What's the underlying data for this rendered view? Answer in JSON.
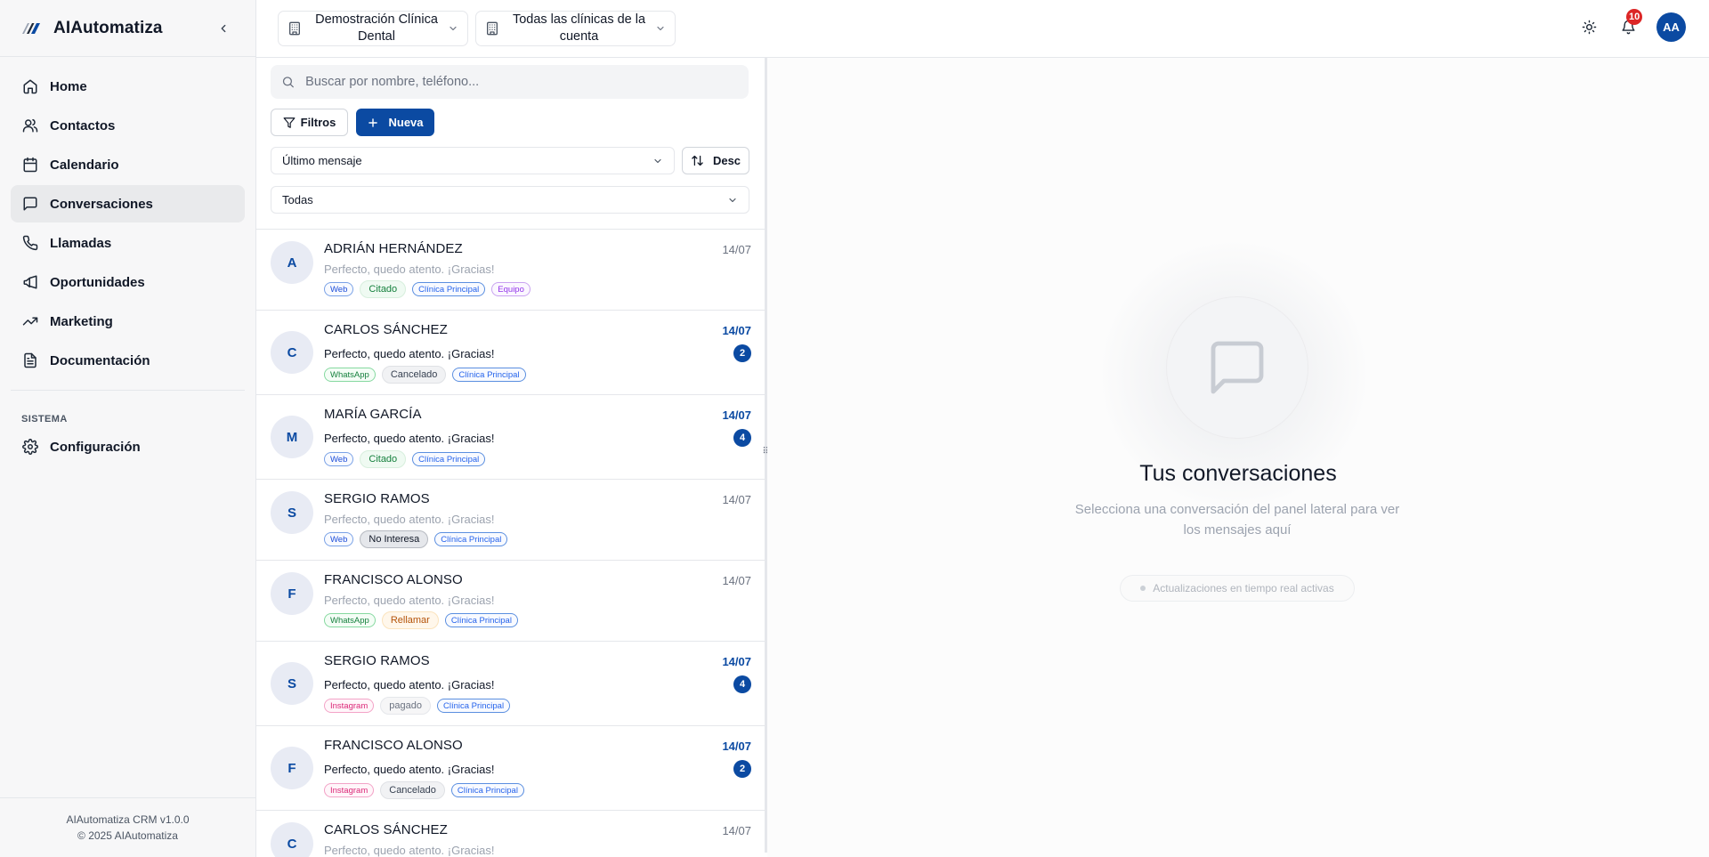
{
  "brand": {
    "name": "AIAutomatiza"
  },
  "nav": {
    "items": [
      {
        "label": "Home",
        "icon": "home-icon"
      },
      {
        "label": "Contactos",
        "icon": "users-icon"
      },
      {
        "label": "Calendario",
        "icon": "calendar-icon"
      },
      {
        "label": "Conversaciones",
        "icon": "message-square-icon",
        "active": true
      },
      {
        "label": "Llamadas",
        "icon": "phone-icon"
      },
      {
        "label": "Oportunidades",
        "icon": "megaphone-icon"
      },
      {
        "label": "Marketing",
        "icon": "trending-up-icon"
      },
      {
        "label": "Documentación",
        "icon": "file-text-icon"
      }
    ],
    "section_label": "SISTEMA",
    "settings_label": "Configuración"
  },
  "footer": {
    "version": "AIAutomatiza CRM v1.0.0",
    "copyright": "© 2025 AIAutomatiza"
  },
  "topbar": {
    "clinic_select": "Demostración Clínica Dental",
    "account_select": "Todas las clínicas de la cuenta",
    "notifications_count": "10",
    "user_initials": "AA"
  },
  "list": {
    "search_placeholder": "Buscar por nombre, teléfono...",
    "filters_label": "Filtros",
    "new_label": "Nueva",
    "sort_value": "Último mensaje",
    "sort_dir_label": "Desc",
    "status_value": "Todas",
    "conversations": [
      {
        "initial": "A",
        "name": "ADRIÁN HERNÁNDEZ",
        "message": "Perfecto, quedo atento. ¡Gracias!",
        "date": "14/07",
        "unread": "",
        "tags": [
          {
            "label": "Web",
            "kind": "web"
          },
          {
            "label": "Citado",
            "kind": "citado"
          },
          {
            "label": "Clínica Principal",
            "kind": "clinic"
          },
          {
            "label": "Equipo",
            "kind": "equipo"
          }
        ]
      },
      {
        "initial": "C",
        "name": "CARLOS SÁNCHEZ",
        "message": "Perfecto, quedo atento. ¡Gracias!",
        "date": "14/07",
        "unread": "2",
        "tags": [
          {
            "label": "WhatsApp",
            "kind": "whatsapp"
          },
          {
            "label": "Cancelado",
            "kind": "cancelado"
          },
          {
            "label": "Clínica Principal",
            "kind": "clinic"
          }
        ]
      },
      {
        "initial": "M",
        "name": "MARÍA GARCÍA",
        "message": "Perfecto, quedo atento. ¡Gracias!",
        "date": "14/07",
        "unread": "4",
        "tags": [
          {
            "label": "Web",
            "kind": "web"
          },
          {
            "label": "Citado",
            "kind": "citado"
          },
          {
            "label": "Clínica Principal",
            "kind": "clinic"
          }
        ]
      },
      {
        "initial": "S",
        "name": "SERGIO RAMOS",
        "message": "Perfecto, quedo atento. ¡Gracias!",
        "date": "14/07",
        "unread": "",
        "tags": [
          {
            "label": "Web",
            "kind": "web"
          },
          {
            "label": "No Interesa",
            "kind": "nointeresa"
          },
          {
            "label": "Clínica Principal",
            "kind": "clinic"
          }
        ]
      },
      {
        "initial": "F",
        "name": "FRANCISCO ALONSO",
        "message": "Perfecto, quedo atento. ¡Gracias!",
        "date": "14/07",
        "unread": "",
        "tags": [
          {
            "label": "WhatsApp",
            "kind": "whatsapp"
          },
          {
            "label": "Rellamar",
            "kind": "rellamar"
          },
          {
            "label": "Clínica Principal",
            "kind": "clinic"
          }
        ]
      },
      {
        "initial": "S",
        "name": "SERGIO RAMOS",
        "message": "Perfecto, quedo atento. ¡Gracias!",
        "date": "14/07",
        "unread": "4",
        "tags": [
          {
            "label": "Instagram",
            "kind": "instagram"
          },
          {
            "label": "pagado",
            "kind": "pagado"
          },
          {
            "label": "Clínica Principal",
            "kind": "clinic"
          }
        ]
      },
      {
        "initial": "F",
        "name": "FRANCISCO ALONSO",
        "message": "Perfecto, quedo atento. ¡Gracias!",
        "date": "14/07",
        "unread": "2",
        "tags": [
          {
            "label": "Instagram",
            "kind": "instagram"
          },
          {
            "label": "Cancelado",
            "kind": "cancelado"
          },
          {
            "label": "Clínica Principal",
            "kind": "clinic"
          }
        ]
      },
      {
        "initial": "C",
        "name": "CARLOS SÁNCHEZ",
        "message": "Perfecto, quedo atento. ¡Gracias!",
        "date": "14/07",
        "unread": "",
        "tags": []
      }
    ]
  },
  "empty_state": {
    "title": "Tus conversaciones",
    "subtitle": "Selecciona una conversación del panel lateral para ver los mensajes aquí",
    "realtime_label": "Actualizaciones en tiempo real activas"
  },
  "colors": {
    "primary": "#0b4aa2",
    "badge_red": "#dc2626",
    "sidebar_bg": "#f7f7f8",
    "active_nav_bg": "#e9eaec"
  }
}
